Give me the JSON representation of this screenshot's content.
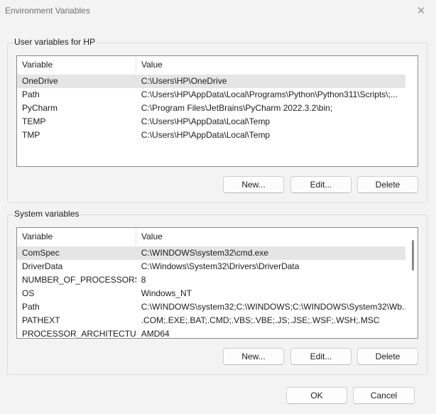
{
  "window": {
    "title": "Environment Variables",
    "close_glyph": "✕"
  },
  "user_vars": {
    "group_label": "User variables for HP",
    "columns": [
      "Variable",
      "Value"
    ],
    "rows": [
      {
        "name": "OneDrive",
        "value": "C:\\Users\\HP\\OneDrive"
      },
      {
        "name": "Path",
        "value": "C:\\Users\\HP\\AppData\\Local\\Programs\\Python\\Python311\\Scripts\\;..."
      },
      {
        "name": "PyCharm",
        "value": "C:\\Program Files\\JetBrains\\PyCharm 2022.3.2\\bin;"
      },
      {
        "name": "TEMP",
        "value": "C:\\Users\\HP\\AppData\\Local\\Temp"
      },
      {
        "name": "TMP",
        "value": "C:\\Users\\HP\\AppData\\Local\\Temp"
      }
    ],
    "buttons": {
      "new": "New...",
      "edit": "Edit...",
      "delete": "Delete"
    }
  },
  "system_vars": {
    "group_label": "System variables",
    "columns": [
      "Variable",
      "Value"
    ],
    "rows": [
      {
        "name": "ComSpec",
        "value": "C:\\WINDOWS\\system32\\cmd.exe"
      },
      {
        "name": "DriverData",
        "value": "C:\\Windows\\System32\\Drivers\\DriverData"
      },
      {
        "name": "NUMBER_OF_PROCESSORS",
        "value": "8"
      },
      {
        "name": "OS",
        "value": "Windows_NT"
      },
      {
        "name": "Path",
        "value": "C:\\WINDOWS\\system32;C:\\WINDOWS;C:\\WINDOWS\\System32\\Wb..."
      },
      {
        "name": "PATHEXT",
        "value": ".COM;.EXE;.BAT;.CMD;.VBS;.VBE;.JS;.JSE;.WSF;.WSH;.MSC"
      },
      {
        "name": "PROCESSOR_ARCHITECTURE",
        "value": "AMD64"
      }
    ],
    "buttons": {
      "new": "New...",
      "edit": "Edit...",
      "delete": "Delete"
    }
  },
  "footer": {
    "ok": "OK",
    "cancel": "Cancel"
  }
}
